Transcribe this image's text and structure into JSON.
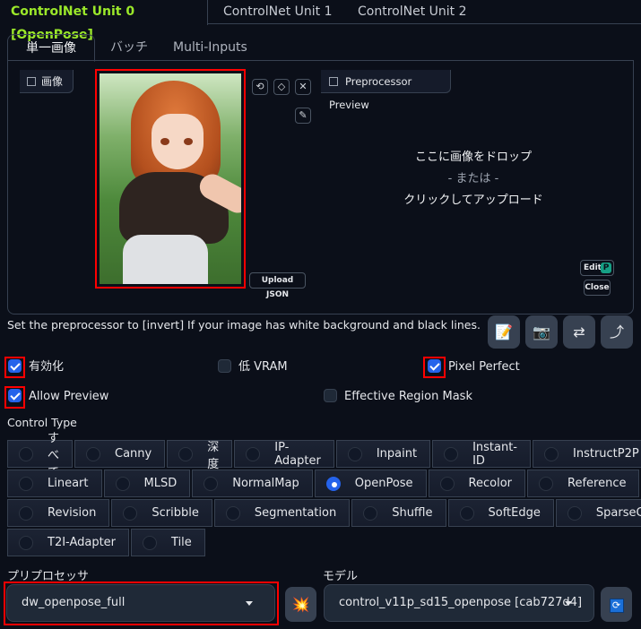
{
  "top_tabs": [
    {
      "label": "ControlNet Unit 0 [OpenPose]",
      "active": true
    },
    {
      "label": "ControlNet Unit 1",
      "active": false
    },
    {
      "label": "ControlNet Unit 2",
      "active": false
    }
  ],
  "sub_tabs": [
    {
      "label": "単一画像",
      "active": true
    },
    {
      "label": "バッチ",
      "active": false
    },
    {
      "label": "Multi-Inputs",
      "active": false
    }
  ],
  "image_panel": {
    "image_label": "画像",
    "preview_label": "Preprocessor Preview",
    "tools": {
      "undo": "undo-icon",
      "erase": "eraser-icon",
      "clear": "close-icon",
      "brush": "brush-icon"
    },
    "tool_glyphs": {
      "undo": "⟲",
      "erase": "◇",
      "clear": "✕",
      "brush": "✎"
    },
    "upload_json_label": "Upload JSON",
    "drop_line1": "ここに画像をドロップ",
    "drop_line2": "- または -",
    "drop_line3": "クリックしてアップロード",
    "edit_label": "Edit",
    "edit_badge": "P",
    "close_label": "Close"
  },
  "hint": "Set the preprocessor to [invert] If your image has white background and black lines.",
  "action_buttons": [
    {
      "icon": "notepad-icon",
      "glyph": "📝"
    },
    {
      "icon": "camera-icon",
      "glyph": "📷"
    },
    {
      "icon": "swap-icon",
      "glyph": "⇄"
    },
    {
      "icon": "send-arrow-icon",
      "glyph": "⤴"
    }
  ],
  "checkboxes": {
    "enable": {
      "label": "有効化",
      "checked": true
    },
    "low_vram": {
      "label": "低 VRAM",
      "checked": false
    },
    "pixel_perfect": {
      "label": "Pixel Perfect",
      "checked": true
    },
    "allow_preview": {
      "label": "Allow Preview",
      "checked": true
    },
    "effective_region_mask": {
      "label": "Effective Region Mask",
      "checked": false
    }
  },
  "control_type": {
    "label": "Control Type",
    "selected": "OpenPose",
    "rows": [
      [
        "すべて",
        "Canny",
        "深度",
        "IP-Adapter",
        "Inpaint",
        "Instant-ID",
        "InstructP2P"
      ],
      [
        "Lineart",
        "MLSD",
        "NormalMap",
        "OpenPose",
        "Recolor",
        "Reference"
      ],
      [
        "Revision",
        "Scribble",
        "Segmentation",
        "Shuffle",
        "SoftEdge",
        "SparseCtrl"
      ],
      [
        "T2I-Adapter",
        "Tile"
      ]
    ]
  },
  "preprocessor": {
    "label": "プリプロセッサ",
    "value": "dw_openpose_full",
    "run_glyph": "💥"
  },
  "model": {
    "label": "モデル",
    "value": "control_v11p_sd15_openpose [cab727d4]",
    "refresh_glyph": "⟳"
  },
  "colors": {
    "accent": "#9be82a",
    "checkbox": "#2563eb",
    "highlight": "#ff0000"
  }
}
